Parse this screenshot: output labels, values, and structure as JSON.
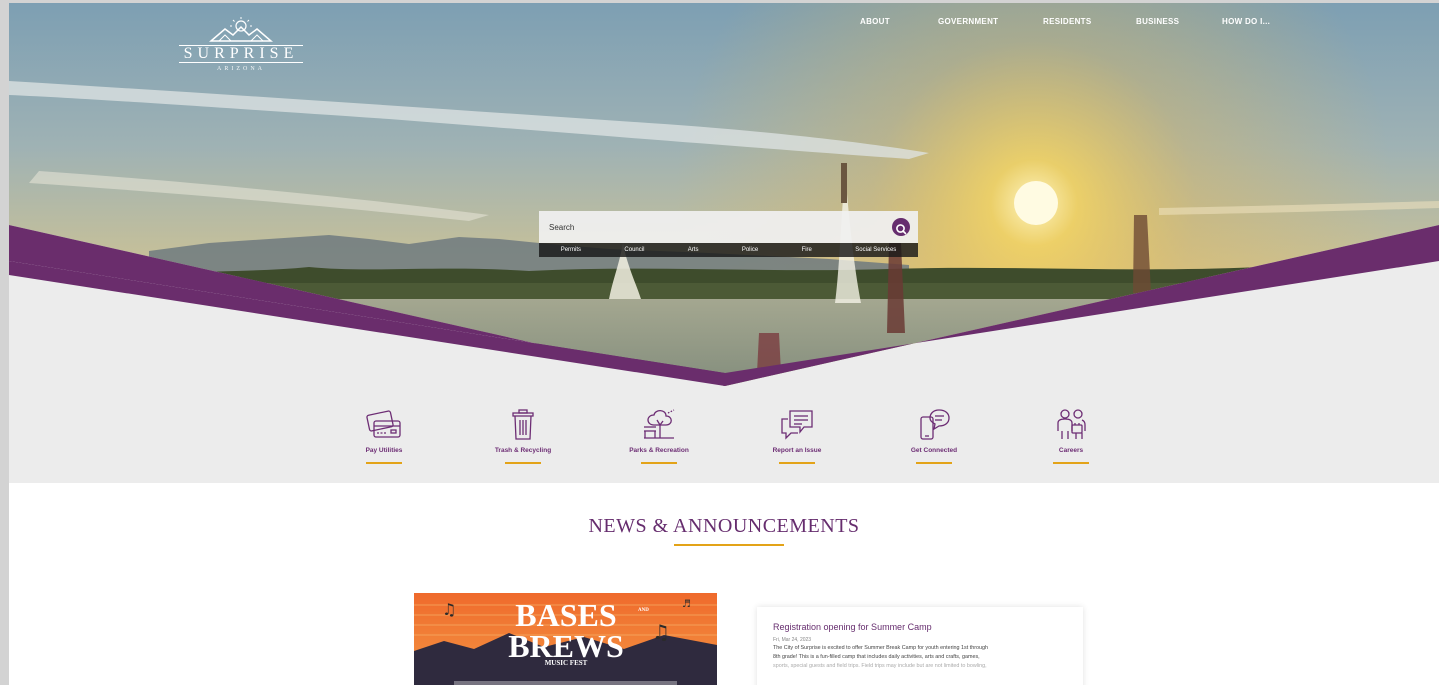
{
  "logo": {
    "name": "SURPRISE",
    "subtitle": "ARIZONA"
  },
  "nav": [
    "ABOUT",
    "GOVERNMENT",
    "RESIDENTS",
    "BUSINESS",
    "HOW DO I..."
  ],
  "search": {
    "placeholder": "Search",
    "quick_links": [
      "Permits",
      "Council",
      "Arts",
      "Police",
      "Fire",
      "Social Services"
    ]
  },
  "services": [
    {
      "label": "Pay Utilities",
      "icon": "credit-card-icon"
    },
    {
      "label": "Trash & Recycling",
      "icon": "trash-can-icon"
    },
    {
      "label": "Parks & Recreation",
      "icon": "park-bench-tree-icon"
    },
    {
      "label": "Report an Issue",
      "icon": "speech-bubble-report-icon"
    },
    {
      "label": "Get Connected",
      "icon": "phone-chat-icon"
    },
    {
      "label": "Careers",
      "icon": "people-briefcase-icon"
    }
  ],
  "news": {
    "heading": "NEWS & ANNOUNCEMENTS",
    "image_text": {
      "line1": "BASES",
      "and": "AND",
      "line2": "BREWS",
      "line3": "MUSIC FEST"
    },
    "card": {
      "title": "Registration opening for Summer Camp",
      "date": "Fri, Mar 24, 2023",
      "body_1": "The City of Surprise is excited to offer Summer Break Camp for youth entering 1st through",
      "body_2": "8th grade! This is a fun-filled camp that includes daily activities, arts and crafts, games,",
      "body_3": "sports, special guests and field trips. Field trips may include but are not limited to bowling,"
    }
  },
  "colors": {
    "brand_purple": "#662d6e",
    "accent_gold": "#e3a318",
    "band_gray": "#ececec"
  }
}
